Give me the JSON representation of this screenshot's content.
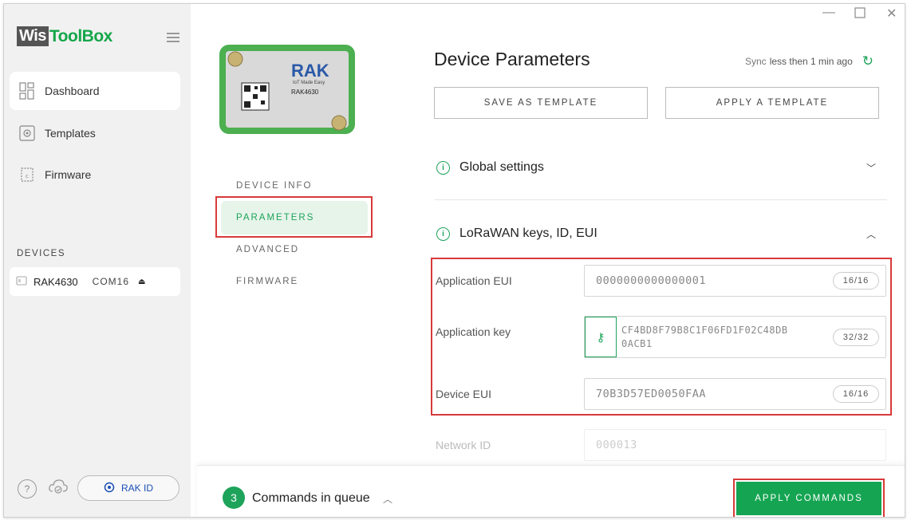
{
  "app": {
    "logo_wis": "Wis",
    "logo_toolbox": "ToolBox"
  },
  "sidebar": {
    "items": [
      {
        "label": "Dashboard",
        "icon": "dashboard-icon",
        "active": true
      },
      {
        "label": "Templates",
        "icon": "templates-icon",
        "active": false
      },
      {
        "label": "Firmware",
        "icon": "chip-icon",
        "active": false
      }
    ],
    "devices_label": "DEVICES",
    "device": {
      "name": "RAK4630",
      "port": "COM16",
      "icon": "device-icon"
    },
    "rakid_label": "RAK ID",
    "help_icon": "?"
  },
  "board": {
    "brand": "RAK",
    "tagline": "IoT Made Easy",
    "model": "RAK4630"
  },
  "subnav": {
    "items": [
      "DEVICE INFO",
      "PARAMETERS",
      "ADVANCED",
      "FIRMWARE"
    ],
    "active": "PARAMETERS"
  },
  "main": {
    "title": "Device Parameters",
    "sync": {
      "prefix": "Sync",
      "text": "less then 1 min ago"
    },
    "save_template": "SAVE AS TEMPLATE",
    "apply_template": "APPLY A TEMPLATE",
    "sections": [
      {
        "title": "Global settings",
        "expanded": false
      },
      {
        "title": "LoRaWAN keys, ID, EUI",
        "expanded": true
      }
    ],
    "fields": [
      {
        "label": "Application EUI",
        "value": "0000000000000001",
        "counter": "16/16"
      },
      {
        "label": "Application key",
        "value": "CF4BD8F79B8C1F06FD1F02C48DB",
        "value_line2": "0ACB1",
        "counter": "32/32"
      },
      {
        "label": "Device EUI",
        "value": "70B3D57ED0050FAA",
        "counter": "16/16"
      },
      {
        "label": "Network ID",
        "value": "000013"
      }
    ]
  },
  "bottom": {
    "queue_count": "3",
    "queue_text": "Commands in queue",
    "apply_label": "APPLY COMMANDS"
  },
  "colors": {
    "accent": "#1ea35b",
    "highlight": "#d83a3a",
    "sidebar_bg": "#f1f1f1"
  }
}
